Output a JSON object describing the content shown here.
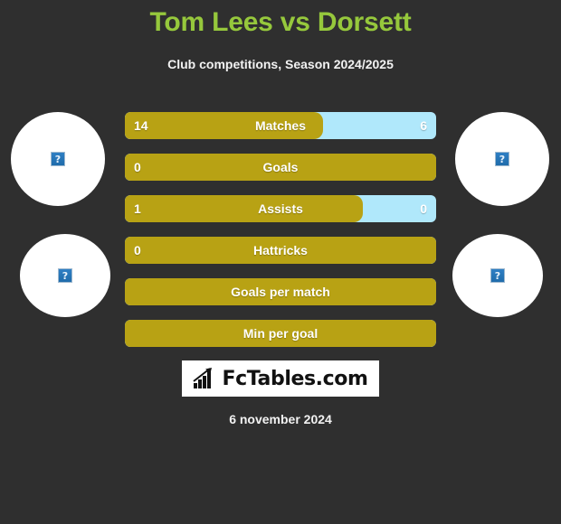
{
  "header": {
    "title": "Tom Lees vs Dorsett",
    "subtitle": "Club competitions, Season 2024/2025",
    "title_color": "#96c83c"
  },
  "avatars": {
    "placeholder_glyph": "?",
    "items": [
      {
        "name": "home-player-avatar-top",
        "side": "left"
      },
      {
        "name": "home-player-avatar-bottom",
        "side": "left"
      },
      {
        "name": "away-player-avatar-top",
        "side": "right"
      },
      {
        "name": "away-player-avatar-bottom",
        "side": "right"
      }
    ]
  },
  "colors": {
    "background": "#2f2f2f",
    "left_bar": "#b8a214",
    "right_bar": "#b0e8fb",
    "accent_green": "#96c83c"
  },
  "chart_data": {
    "type": "bar",
    "title": "Tom Lees vs Dorsett",
    "subtitle": "Club competitions, Season 2024/2025",
    "orientation": "horizontal-diverging",
    "series": [
      {
        "name": "Tom Lees",
        "color": "#b8a214",
        "align": "left"
      },
      {
        "name": "Dorsett",
        "color": "#b0e8fb",
        "align": "right"
      }
    ],
    "categories": [
      "Matches",
      "Goals",
      "Assists",
      "Hattricks",
      "Goals per match",
      "Min per goal"
    ],
    "rows": [
      {
        "label": "Matches",
        "left_value": "14",
        "right_value": "6",
        "left_pct": 63.7
      },
      {
        "label": "Goals",
        "left_value": "0",
        "right_value": "",
        "left_pct": 100
      },
      {
        "label": "Assists",
        "left_value": "1",
        "right_value": "0",
        "left_pct": 76.5
      },
      {
        "label": "Hattricks",
        "left_value": "0",
        "right_value": "",
        "left_pct": 100
      },
      {
        "label": "Goals per match",
        "left_value": "",
        "right_value": "",
        "left_pct": 100
      },
      {
        "label": "Min per goal",
        "left_value": "",
        "right_value": "",
        "left_pct": 100
      }
    ]
  },
  "logo": {
    "text": "FcTables.com",
    "icon": "bar-chart-icon"
  },
  "footer": {
    "date": "6 november 2024"
  }
}
